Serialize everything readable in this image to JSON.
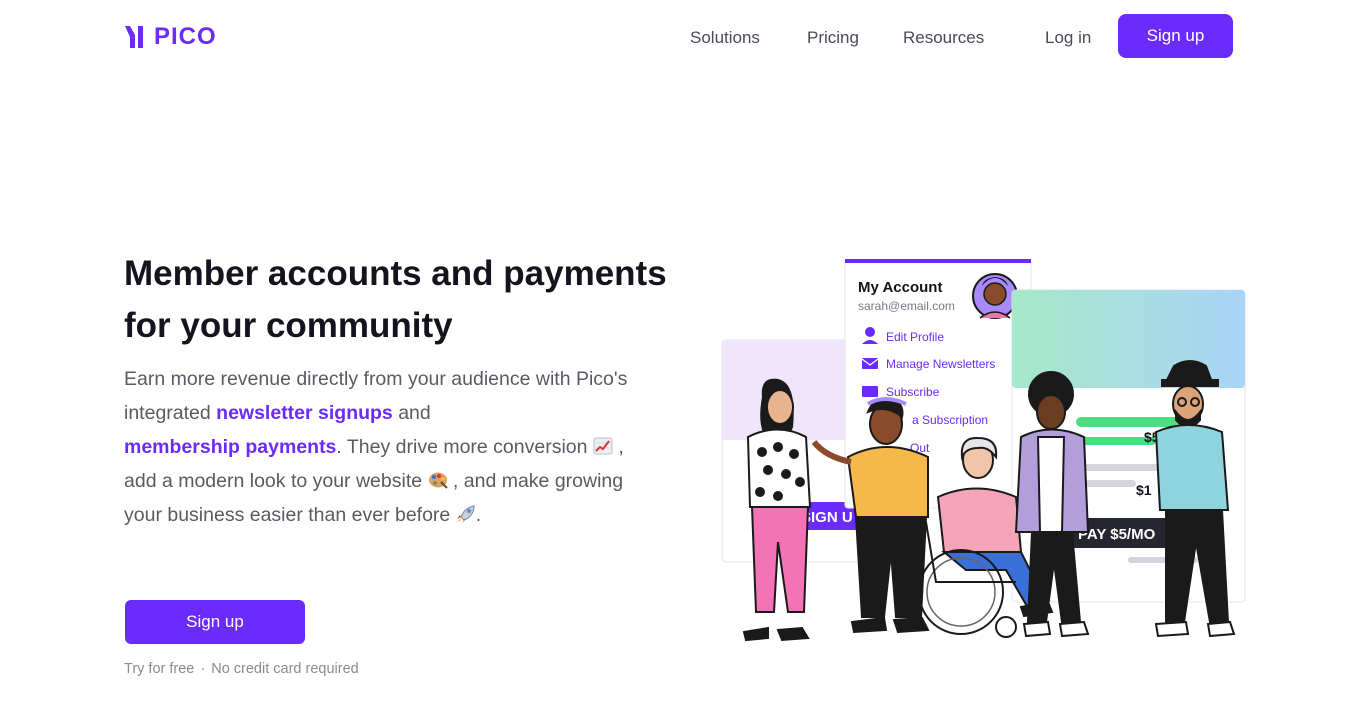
{
  "brand": {
    "name": "PICO",
    "color": "#6b2bfa"
  },
  "nav": {
    "links": [
      "Solutions",
      "Pricing",
      "Resources"
    ],
    "login_label": "Log in",
    "signup_label": "Sign up"
  },
  "hero": {
    "headline_line1": "Member accounts and payments",
    "headline_line2": "for your community",
    "body": {
      "p1": "Earn more revenue directly from your audience with Pico's integrated ",
      "link1": "newsletter signups",
      "p2": " and ",
      "link2": "membership payments",
      "p3": ". They drive more conversion ",
      "p4": " , add a modern look to your website ",
      "p5": " , and make growing your business easier than ever before ",
      "p6": "."
    },
    "emoji_icons": [
      "chart-increasing-icon",
      "palette-icon",
      "rocket-icon"
    ],
    "cta_label": "Sign up",
    "fineprint_left": "Try for free",
    "fineprint_sep": "·",
    "fineprint_right": "No credit card required"
  },
  "illustration": {
    "account_card": {
      "title": "My Account",
      "email": "sarah@email.com",
      "menu": [
        "Edit Profile",
        "Manage Newsletters",
        "Subscribe",
        "a Subscription",
        "Out"
      ]
    },
    "signup_banner": "SIGN U",
    "pricing_card": {
      "price1": "$5/",
      "price2": "$1",
      "pay_button": "PAY $5/MO"
    }
  }
}
